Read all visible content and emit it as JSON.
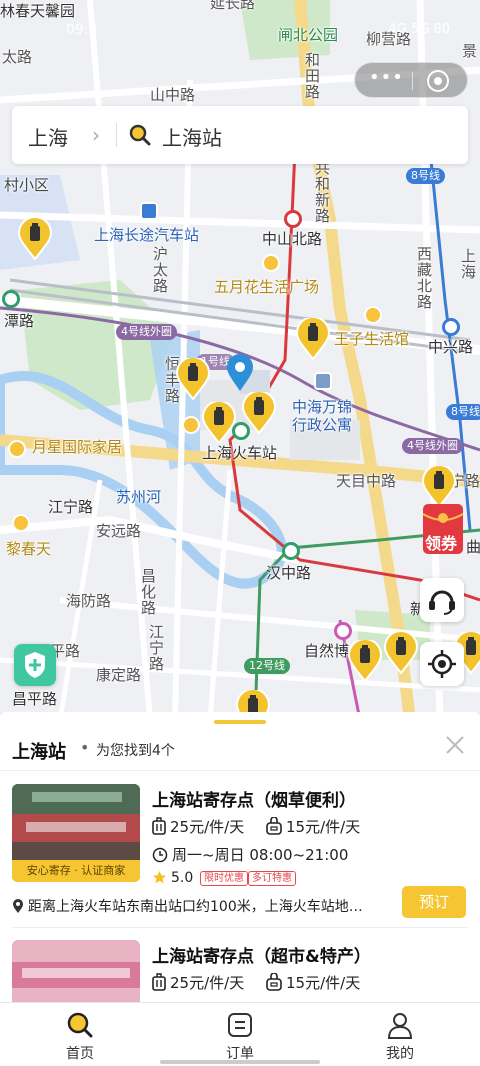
{
  "status_bar": {
    "time": "09:3",
    "right": "4G 5G 80"
  },
  "search": {
    "city": "上海",
    "query": "上海站"
  },
  "map": {
    "labels": {
      "l1": "林春天馨园",
      "l2": "延长路",
      "l3": "闸北公园",
      "l4": "柳营路",
      "l5": "景",
      "l6": "太路",
      "l7": "山中路",
      "l8": "和田路",
      "l9": "村小区",
      "l10": "上海长途汽车站",
      "l11": "中山北路",
      "l12": "五月花生活广场",
      "l13": "共和新路",
      "l14": "沪太路",
      "l15": "潭路",
      "l16": "王子生活馆",
      "l17": "中兴路",
      "l18": "中海万锦行政公寓",
      "l19": "上海火车站",
      "l20": "月星国际家居",
      "l21": "天目中路",
      "l22": "宁路",
      "l23": "江宁路",
      "l24": "苏州河",
      "l25": "安远路",
      "l26": "黎春天",
      "l27": "海防路",
      "l28": "昌化路",
      "l29": "江宁路",
      "l30": "汉中路",
      "l31": "自然博",
      "l32": "平路",
      "l33": "康定路",
      "l34": "昌平路",
      "l35": "西藏北路",
      "l36": "上海",
      "l37": "曲",
      "l38": "新",
      "l39": "恒丰路"
    },
    "badges": {
      "b1": "4号线外圈",
      "b2": "8号线",
      "b3": "4号线外圈",
      "b4": "8号线",
      "b5": "12号线",
      "b6": "1号线"
    },
    "coupon_label": "领券"
  },
  "sheet": {
    "location": "上海站",
    "dot": "•",
    "result_text": "为您找到4个",
    "cards": [
      {
        "name": "上海站寄存点（烟草便利）",
        "price_small": "25元/件/天",
        "price_large": "15元/件/天",
        "hours": "周一~周日 08:00~21:00",
        "rating": "5.0",
        "chips": [
          "限时优惠",
          "多订特惠"
        ],
        "tag": "安心寄存 · 认证商家",
        "address": "距离上海火车站东南出站口约100米，上海火车站地…",
        "book_label": "预订"
      },
      {
        "name": "上海站寄存点（超市&特产）",
        "price_small": "25元/件/天",
        "price_large": "15元/件/天"
      }
    ]
  },
  "tabs": [
    {
      "label": "首页",
      "icon": "search-icon"
    },
    {
      "label": "订单",
      "icon": "order-icon"
    },
    {
      "label": "我的",
      "icon": "profile-icon"
    }
  ],
  "colors": {
    "accent": "#f6c532",
    "metro_red": "#d9393e",
    "metro_green": "#2e9e6a"
  }
}
